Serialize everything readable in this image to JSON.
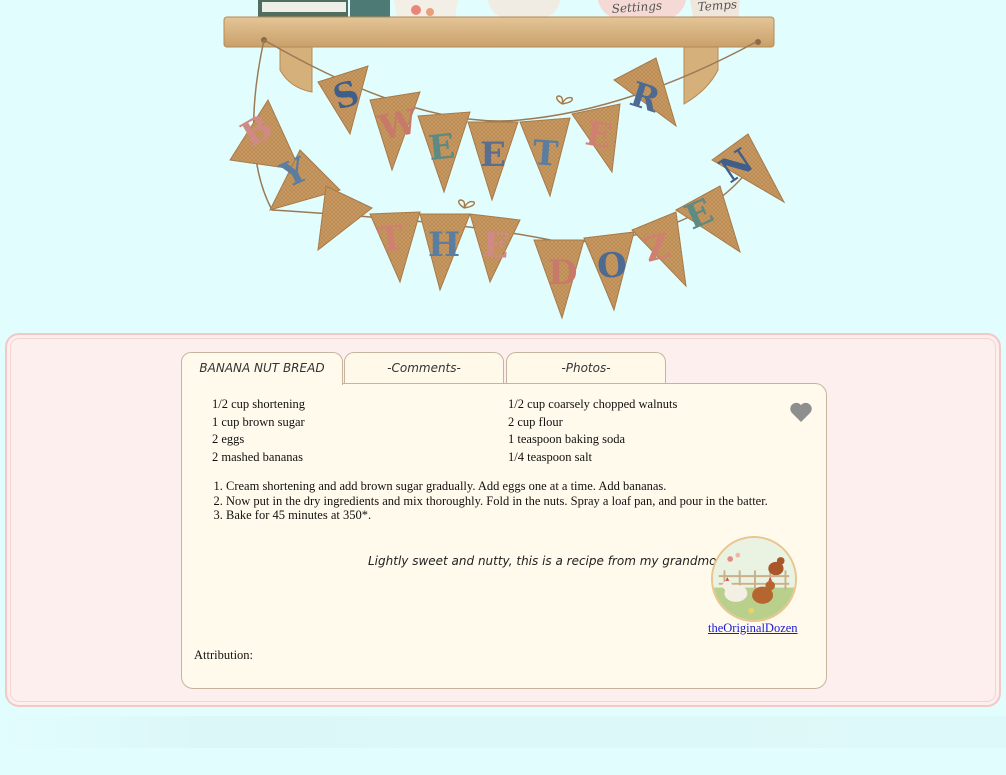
{
  "header": {
    "shelf_labels": [
      "Settings",
      "Temps"
    ],
    "banner_top": [
      "S",
      "W",
      "E",
      "E",
      "T",
      "E",
      "R"
    ],
    "banner_bottom": [
      "B",
      "Y",
      "T",
      "H",
      "E",
      "D",
      "O",
      "Z",
      "E",
      "N"
    ]
  },
  "tabs": {
    "recipe": "BANANA NUT BREAD",
    "comments": "-Comments-",
    "photos": "-Photos-"
  },
  "ingredients": {
    "left": [
      "1/2 cup shortening",
      "1 cup brown sugar",
      "2 eggs",
      "2 mashed bananas"
    ],
    "right": [
      "1/2 cup coarsely chopped walnuts",
      "2 cup flour",
      "1 teaspoon baking soda",
      "1/4 teaspoon salt"
    ]
  },
  "steps": [
    "Cream shortening and add brown sugar gradually. Add eggs one at a time. Add bananas.",
    "Now put in the dry ingredients and mix thoroughly. Fold in the nuts. Spray a loaf pan, and pour in the batter.",
    "Bake for 45 minutes at 350*."
  ],
  "note": "Lightly sweet and nutty, this is a recipe from my grandmother.",
  "author": {
    "name": "theOriginalDozen",
    "avatar_icon": "chickens-avatar-icon"
  },
  "attribution_label": "Attribution:",
  "favorite_icon": "heart-icon",
  "colors": {
    "page_bg": "#e2fdfd",
    "panel_bg": "#fdefee",
    "card_bg": "#fffaec",
    "burlap": "#c99a62",
    "link": "#1a1ad6"
  }
}
